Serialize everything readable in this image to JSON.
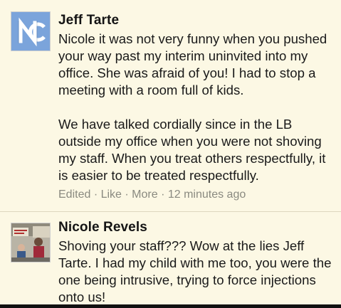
{
  "comments": [
    {
      "author": "Jeff Tarte",
      "avatar_icon": "unc-logo-icon",
      "body_lines": [
        "Nicole it was not very funny when you pushed",
        "your way past my interim uninvited into my",
        "office. She was afraid of you! I had to stop a",
        "meeting with a room full of kids.",
        "",
        "We have talked cordially since in the LB",
        "outside my office when you were not shoving",
        "my staff. When you treat others respectfully, it",
        "is easier to be treated respectfully."
      ],
      "meta": {
        "edited": "Edited",
        "sep1": " · ",
        "like": "Like",
        "sep2": " · ",
        "more": "More",
        "sep3": " · ",
        "time": "12 minutes ago"
      }
    },
    {
      "author": "Nicole Revels",
      "avatar_icon": "profile-photo-icon",
      "body_lines": [
        "Shoving your staff??? Wow at the lies Jeff",
        "Tarte. I had my child with me too, you were the",
        "one being intrusive, trying to force injections",
        "onto us!"
      ]
    }
  ],
  "colors": {
    "background": "#fcf8e4",
    "unc_blue": "#7ba4db",
    "meta_text": "#8a8a80"
  }
}
